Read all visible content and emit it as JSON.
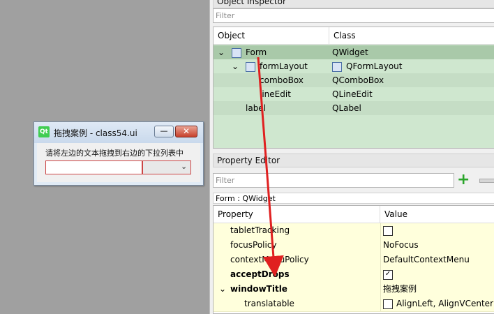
{
  "form_window": {
    "title": "拖拽案例 - class54.ui",
    "logo_text": "Qt",
    "minimize_symbol": "—",
    "close_symbol": "✕",
    "label": "请将左边的文本拖拽到右边的下拉列表中",
    "combo_arrow": "⌄"
  },
  "object_inspector": {
    "title": "Object Inspector",
    "filter_placeholder": "Filter",
    "col_object": "Object",
    "col_class": "Class",
    "rows": [
      {
        "object": "Form",
        "class": "QWidget",
        "expand": "⌄"
      },
      {
        "object": "formLayout",
        "class": "QFormLayout",
        "expand": "⌄"
      },
      {
        "object": "comboBox",
        "class": "QComboBox"
      },
      {
        "object": "lineEdit",
        "class": "QLineEdit"
      },
      {
        "object": "label",
        "class": "QLabel"
      }
    ]
  },
  "property_editor": {
    "title": "Property Editor",
    "filter_placeholder": "Filter",
    "add_symbol": "+",
    "class_line": "Form : QWidget",
    "col_property": "Property",
    "col_value": "Value",
    "rows": [
      {
        "name": "tabletTracking",
        "value": ""
      },
      {
        "name": "focusPolicy",
        "value": "NoFocus"
      },
      {
        "name": "contextMenuPolicy",
        "value": "DefaultContextMenu"
      },
      {
        "name": "acceptDrops",
        "value": "✓"
      },
      {
        "name": "windowTitle",
        "value": "拖拽案例",
        "expand": "⌄"
      },
      {
        "name": "translatable",
        "value": "AlignLeft, AlignVCenter"
      }
    ]
  },
  "colors": {
    "arrow": "#e02020",
    "selection": "#a9c9a9",
    "tree_bg": "#cfe7cf",
    "property_row": "#ffffdc"
  }
}
